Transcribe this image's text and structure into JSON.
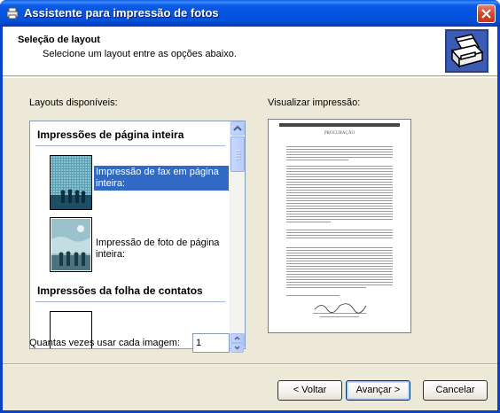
{
  "window": {
    "title": "Assistente para impressão de fotos"
  },
  "header": {
    "title": "Seleção de layout",
    "subtitle": "Selecione um layout entre as opções abaixo."
  },
  "layouts": {
    "label": "Layouts disponíveis:",
    "groups": [
      {
        "title": "Impressões de página inteira"
      },
      {
        "title": "Impressões da folha de contatos"
      }
    ],
    "items": [
      {
        "label": "Impressão de fax em página inteira:",
        "selected": true,
        "thumb_icon": "fax-photo-icon"
      },
      {
        "label": "Impressão de foto de página inteira:",
        "selected": false,
        "thumb_icon": "photo-icon"
      }
    ]
  },
  "preview": {
    "label": "Visualizar impressão:"
  },
  "quantity": {
    "label": "Quantas vezes usar cada imagem:",
    "value": "1"
  },
  "buttons": {
    "back": "< Voltar",
    "next": "Avançar >",
    "cancel": "Cancelar"
  },
  "colors": {
    "title_bar": "#0553e0",
    "selection": "#316ac5",
    "dialog_bg": "#ece9d8"
  }
}
